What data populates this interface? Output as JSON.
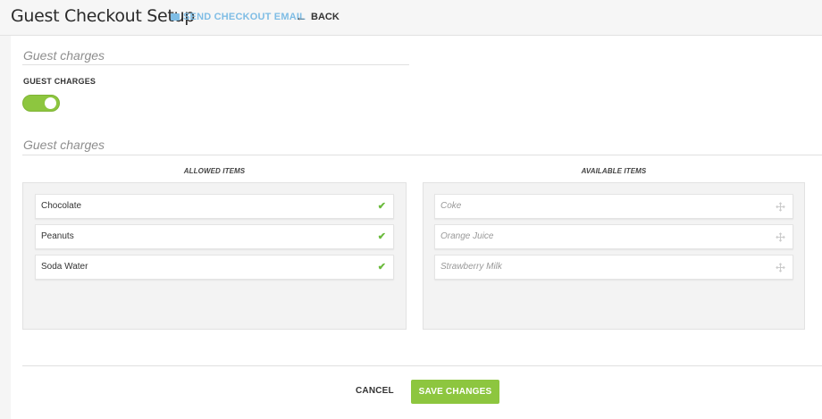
{
  "header": {
    "title": "Guest Checkout Setup",
    "send_email_label": "SEND CHECKOUT EMAIL",
    "back_label": "BACK"
  },
  "section1": {
    "heading": "Guest charges",
    "toggle_label": "GUEST CHARGES",
    "toggle_on": true
  },
  "section2": {
    "heading": "Guest charges",
    "allowed_header": "ALLOWED ITEMS",
    "available_header": "AVAILABLE ITEMS",
    "allowed_items": [
      "Chocolate",
      "Peanuts",
      "Soda Water"
    ],
    "available_items": [
      "Coke",
      "Orange Juice",
      "Strawberry Milk"
    ]
  },
  "footer": {
    "cancel_label": "CANCEL",
    "save_label": "SAVE CHANGES"
  },
  "colors": {
    "accent_green": "#8dc63f",
    "link_blue": "#7fbde5",
    "check_green": "#6aba3b"
  }
}
